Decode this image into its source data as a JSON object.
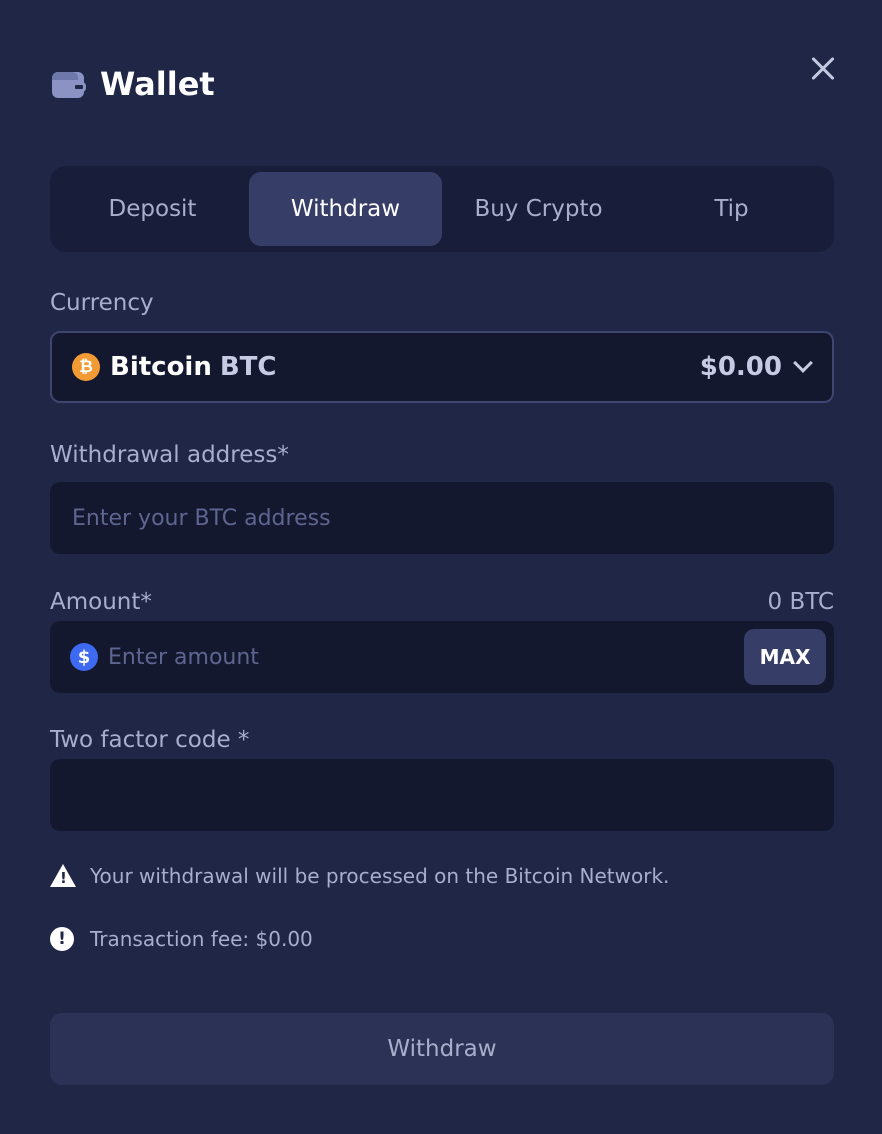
{
  "header": {
    "title": "Wallet",
    "icon": "wallet-icon",
    "close_icon": "close-icon"
  },
  "tabs": [
    {
      "label": "Deposit",
      "active": false
    },
    {
      "label": "Withdraw",
      "active": true
    },
    {
      "label": "Buy Crypto",
      "active": false
    },
    {
      "label": "Tip",
      "active": false
    }
  ],
  "currency": {
    "label": "Currency",
    "icon_glyph": "₿",
    "name": "Bitcoin",
    "code": "BTC",
    "balance": "$0.00"
  },
  "address": {
    "label": "Withdrawal address*",
    "placeholder": "Enter your BTC address",
    "value": ""
  },
  "amount": {
    "label": "Amount*",
    "available": "0 BTC",
    "icon_glyph": "$",
    "placeholder": "Enter amount",
    "max_label": "MAX"
  },
  "two_factor": {
    "label": "Two factor code *",
    "value": ""
  },
  "notices": {
    "network": "Your withdrawal will be processed on the Bitcoin Network.",
    "fee": "Transaction fee: $0.00"
  },
  "submit": {
    "label": "Withdraw"
  },
  "colors": {
    "background": "#1f2646",
    "panel": "#181e3a",
    "input": "#14182f",
    "active_tab": "#363d66",
    "bitcoin": "#f29b34",
    "usd": "#3d6af0"
  }
}
